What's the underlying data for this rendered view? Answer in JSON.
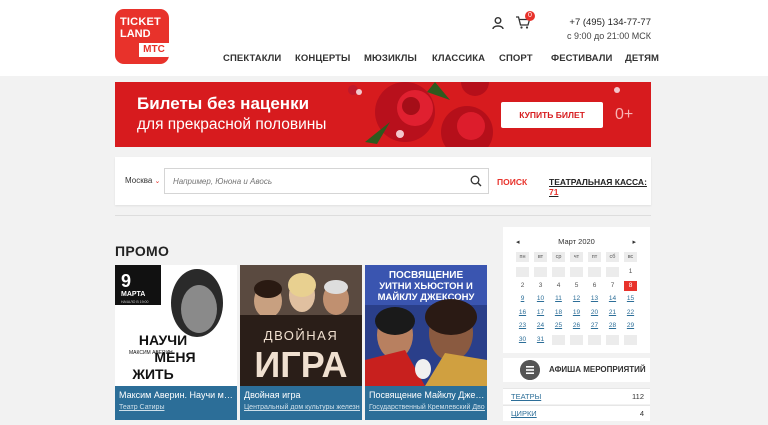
{
  "header": {
    "logo_line1": "TICKET",
    "logo_line2": "LAND",
    "logo_partner": "МТС",
    "cart_count": "0",
    "phone": "+7 (495) 134-77-77",
    "hours": "с 9:00 до 21:00 МСК",
    "nav": [
      "СПЕКТАКЛИ",
      "КОНЦЕРТЫ",
      "МЮЗИКЛЫ",
      "КЛАССИКА",
      "СПОРТ",
      "ФЕСТИВАЛИ",
      "ДЕТЯМ"
    ]
  },
  "banner": {
    "line1": "Билеты без наценки",
    "line2": "для прекрасной половины",
    "button": "КУПИТЬ БИЛЕТ",
    "age": "0+"
  },
  "search": {
    "city": "Москва",
    "placeholder": "Например, Юнона и Авось",
    "button": "ПОИСК",
    "kassa_label": "ТЕАТРАЛЬНАЯ КАССА:",
    "kassa_count": "71"
  },
  "promo": {
    "title": "ПРОМО",
    "cards": [
      {
        "name": "Максим Аверин. Научи мен...",
        "place": "Театр Сатиры",
        "poster_day": "9",
        "poster_month": "МАРТА",
        "poster_time": "НАЧАЛО В 19:00",
        "poster_author": "МАКСИМ АВЕРИН",
        "poster_lines": [
          "НАУЧИ",
          "МЕНЯ",
          "ЖИТЬ"
        ]
      },
      {
        "name": "Двойная игра",
        "place": "Центральный дом культуры железно",
        "poster_lines": [
          "ДВОЙНАЯ",
          "ИГРА"
        ]
      },
      {
        "name": "Посвящение Майклу Джек...",
        "place": "Государственный Кремлевский Двор",
        "poster_lines": [
          "ПОСВЯЩЕНИЕ",
          "УИТНИ ХЬЮСТОН И",
          "МАЙКЛУ ДЖЕКСОНУ"
        ]
      }
    ]
  },
  "calendar": {
    "month": "Март 2020",
    "prev": "◂",
    "next": "▸",
    "weekdays": [
      "пн",
      "вт",
      "ср",
      "чт",
      "пт",
      "сб",
      "вс"
    ],
    "selected_day": "8",
    "weeks": [
      [
        "",
        "",
        "",
        "",
        "",
        "",
        "1"
      ],
      [
        "2",
        "3",
        "4",
        "5",
        "6",
        "7",
        "8"
      ],
      [
        "9",
        "10",
        "11",
        "12",
        "13",
        "14",
        "15"
      ],
      [
        "16",
        "17",
        "18",
        "19",
        "20",
        "21",
        "22"
      ],
      [
        "23",
        "24",
        "25",
        "26",
        "27",
        "28",
        "29"
      ],
      [
        "30",
        "31",
        "",
        "",
        "",
        "",
        ""
      ]
    ]
  },
  "afisha": {
    "title": "АФИША МЕРОПРИЯТИЙ",
    "rows": [
      {
        "label": "ТЕАТРЫ",
        "count": "112"
      },
      {
        "label": "ЦИРКИ",
        "count": "4"
      }
    ]
  },
  "colors": {
    "brand_red": "#e8322b",
    "banner_red": "#d71b1e",
    "card_caption": "#2c6e98"
  }
}
